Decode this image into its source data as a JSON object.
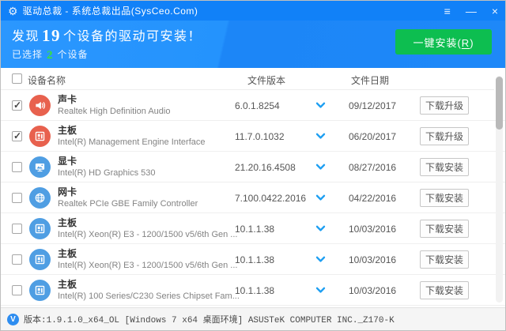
{
  "titlebar": {
    "app_icon_glyph": "⚙",
    "title": "驱动总裁 - 系统总裁出品(SysCeo.Com)",
    "menu_glyph": "≡",
    "minimize_glyph": "—",
    "close_glyph": "×"
  },
  "banner": {
    "headline_prefix": "发现",
    "device_count": "19",
    "headline_suffix": "个设备的驱动可安装！",
    "selected_prefix": "已选择",
    "selected_count": "2",
    "selected_suffix": "个设备",
    "install_button": {
      "pre": "一键安装(",
      "hotkey": "R",
      "post": ")"
    }
  },
  "table": {
    "columns": {
      "device": "设备名称",
      "version": "文件版本",
      "date": "文件日期"
    }
  },
  "rows": [
    {
      "checked": true,
      "icon": "speaker-icon",
      "icon_color": "#e8614e",
      "category": "声卡",
      "device": "Realtek High Definition Audio",
      "version": "6.0.1.8254",
      "date": "09/12/2017",
      "action": "下载升级"
    },
    {
      "checked": true,
      "icon": "motherboard-icon",
      "icon_color": "#e8614e",
      "category": "主板",
      "device": "Intel(R) Management Engine Interface",
      "version": "11.7.0.1032",
      "date": "06/20/2017",
      "action": "下载升级"
    },
    {
      "checked": false,
      "icon": "display-icon",
      "icon_color": "#4f9ee3",
      "category": "显卡",
      "device": "Intel(R) HD Graphics 530",
      "version": "21.20.16.4508",
      "date": "08/27/2016",
      "action": "下载安装"
    },
    {
      "checked": false,
      "icon": "globe-icon",
      "icon_color": "#4f9ee3",
      "category": "网卡",
      "device": "Realtek PCIe GBE Family Controller",
      "version": "7.100.0422.2016",
      "date": "04/22/2016",
      "action": "下载安装"
    },
    {
      "checked": false,
      "icon": "motherboard-icon",
      "icon_color": "#4f9ee3",
      "category": "主板",
      "device": "Intel(R) Xeon(R) E3 - 1200/1500 v5/6th Gen ...",
      "version": "10.1.1.38",
      "date": "10/03/2016",
      "action": "下载安装"
    },
    {
      "checked": false,
      "icon": "motherboard-icon",
      "icon_color": "#4f9ee3",
      "category": "主板",
      "device": "Intel(R) Xeon(R) E3 - 1200/1500 v5/6th Gen ...",
      "version": "10.1.1.38",
      "date": "10/03/2016",
      "action": "下载安装"
    },
    {
      "checked": false,
      "icon": "motherboard-icon",
      "icon_color": "#4f9ee3",
      "category": "主板",
      "device": "Intel(R) 100 Series/C230 Series Chipset Fam...",
      "version": "10.1.1.38",
      "date": "10/03/2016",
      "action": "下载安装"
    }
  ],
  "footer": {
    "badge": "V",
    "text": "版本:1.9.1.0_x64_OL [Windows 7 x64 桌面环境] ASUSTeK COMPUTER INC._Z170-K"
  },
  "colors": {
    "titlebar_blue": "#1181f8",
    "banner_blue": "#1e88f8",
    "install_green": "#0dbe50",
    "count_green": "#3ae33a",
    "icon_orange": "#e8614e",
    "icon_blue": "#4f9ee3",
    "chevron_blue": "#1e9ff2"
  }
}
